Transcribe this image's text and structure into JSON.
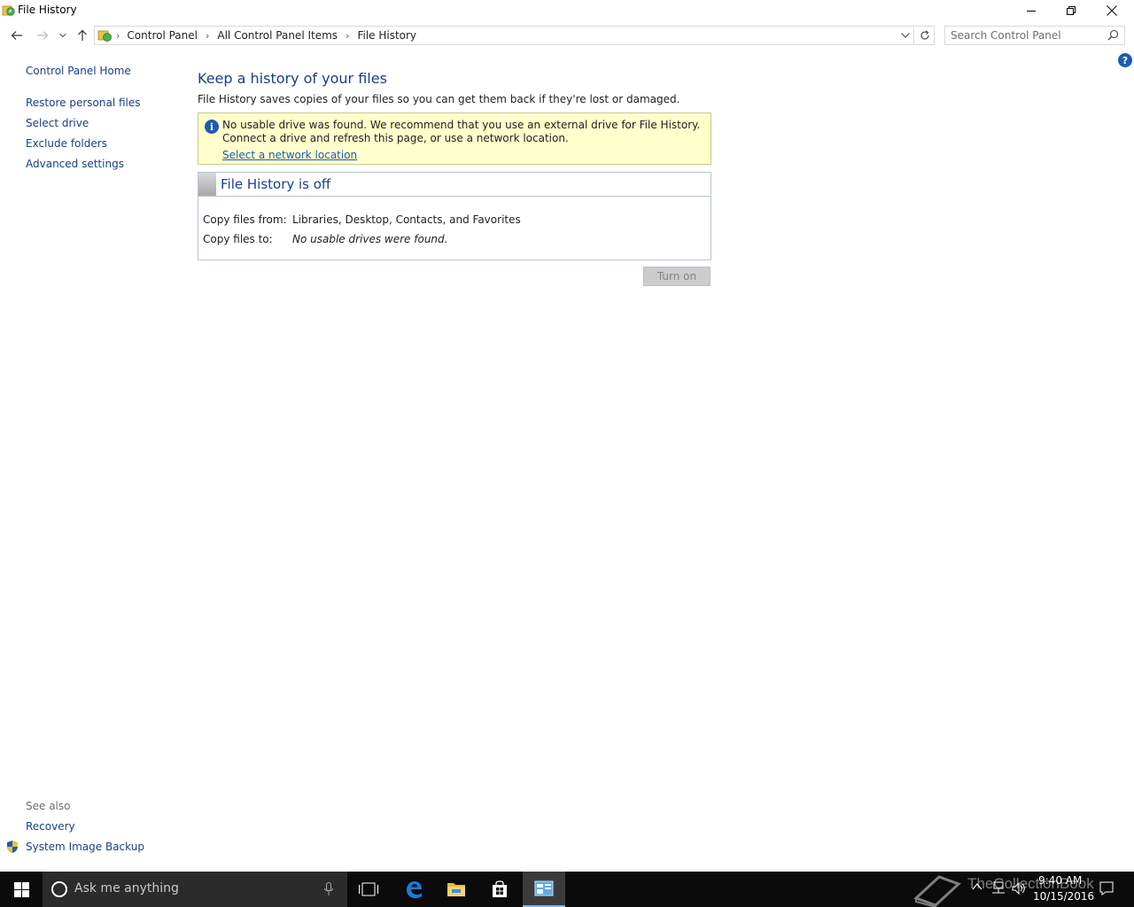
{
  "window": {
    "title": "File History"
  },
  "address": {
    "crumbs": [
      "Control Panel",
      "All Control Panel Items",
      "File History"
    ],
    "search_placeholder": "Search Control Panel"
  },
  "leftnav": {
    "home": "Control Panel Home",
    "items": [
      "Restore personal files",
      "Select drive",
      "Exclude folders",
      "Advanced settings"
    ],
    "see_also_label": "See also",
    "see_also": [
      "Recovery",
      "System Image Backup"
    ]
  },
  "main": {
    "title": "Keep a history of your files",
    "description": "File History saves copies of your files so you can get them back if they're lost or damaged.",
    "info": {
      "message": "No usable drive was found. We recommend that you use an external drive for File History. Connect a drive and refresh this page, or use a network location.",
      "link": "Select a network location"
    },
    "status": {
      "title": "File History is off",
      "copy_from_label": "Copy files from:",
      "copy_from_value": "Libraries, Desktop, Contacts, and Favorites",
      "copy_to_label": "Copy files to:",
      "copy_to_value": "No usable drives were found."
    },
    "turn_on_label": "Turn on"
  },
  "taskbar": {
    "search_placeholder": "Ask me anything",
    "time": "9:40 AM",
    "date": "10/15/2016",
    "watermark": "TheCollectionBook"
  },
  "colors": {
    "link": "#1a3e8c",
    "info_bg": "#ffffcc",
    "taskbar": "#0b0b0b",
    "accent": "#1f5ab4"
  }
}
